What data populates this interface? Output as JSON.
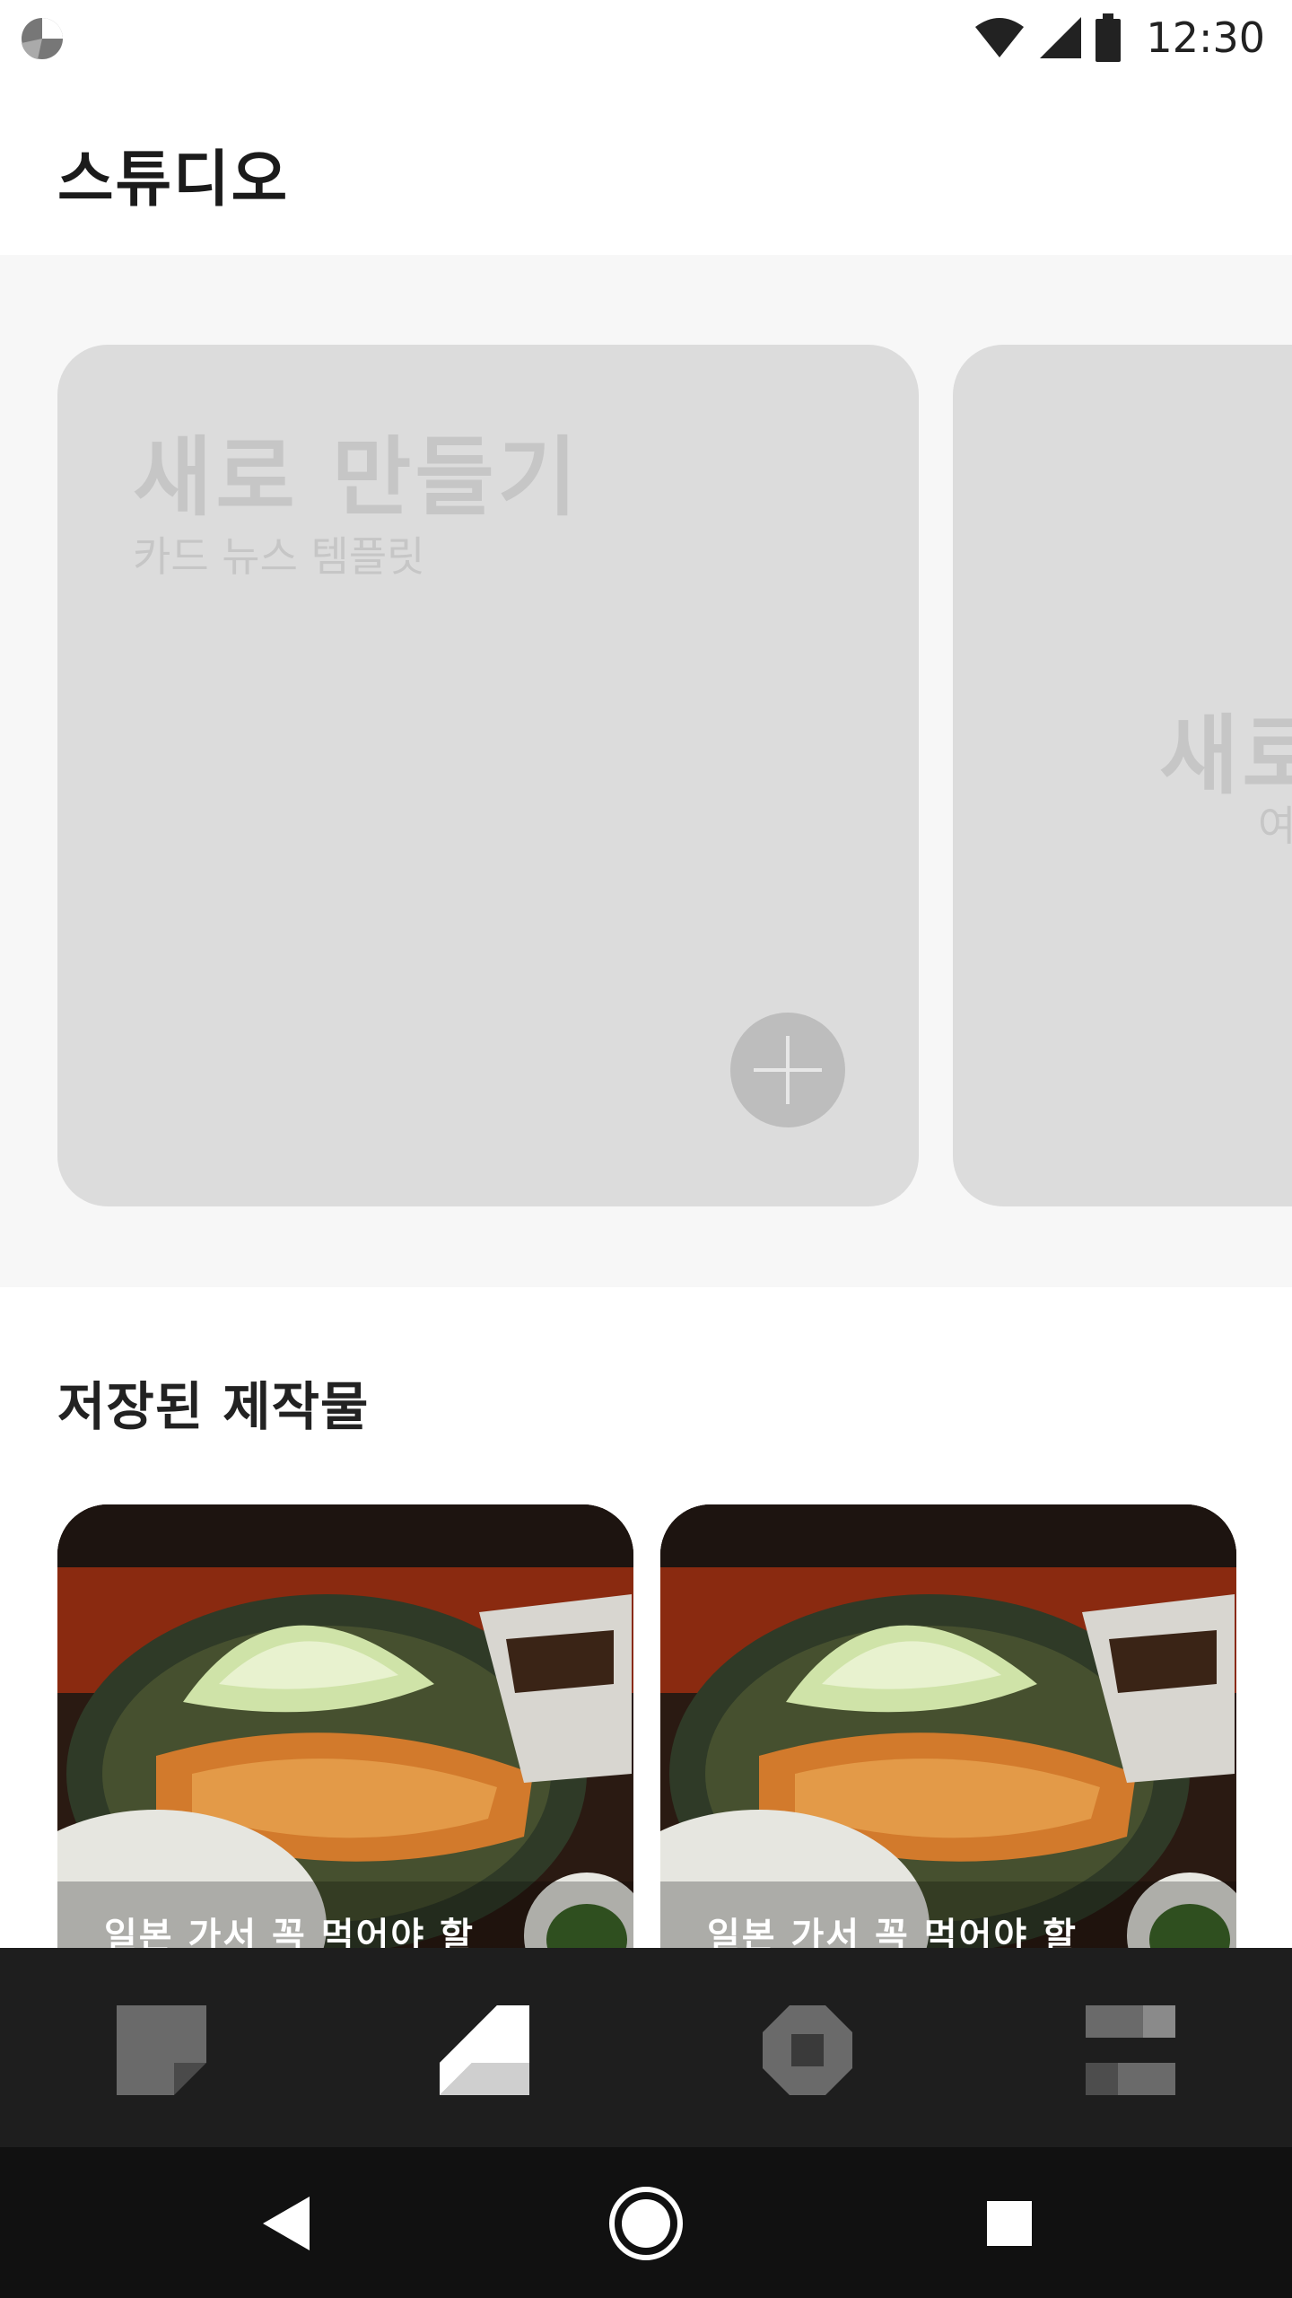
{
  "status_bar": {
    "time": "12:30",
    "icons": [
      "app-logo-icon",
      "wifi-icon",
      "signal-icon",
      "battery-icon"
    ]
  },
  "header": {
    "title": "스튜디오"
  },
  "templates": [
    {
      "title": "새로 만들기",
      "subtitle": "카드 뉴스 템플릿",
      "action_icon": "plus-icon"
    },
    {
      "title": "새로",
      "subtitle": "여"
    }
  ],
  "saved": {
    "title": "저장된 제작물",
    "items": [
      {
        "caption": "일본 가서 꼭 먹어야 할"
      },
      {
        "caption": "일본 가서 꼭 먹어야 할"
      }
    ]
  },
  "bottom_nav": {
    "items": [
      "card-news-icon",
      "studio-icon",
      "explore-icon",
      "menu-list-icon"
    ],
    "active_index": 1
  },
  "system_nav": [
    "back-icon",
    "home-icon",
    "recent-apps-icon"
  ],
  "colors": {
    "card_bg": "#dcdcdc",
    "nav_bg": "#1e1e1e",
    "system_nav_bg": "#111111"
  }
}
